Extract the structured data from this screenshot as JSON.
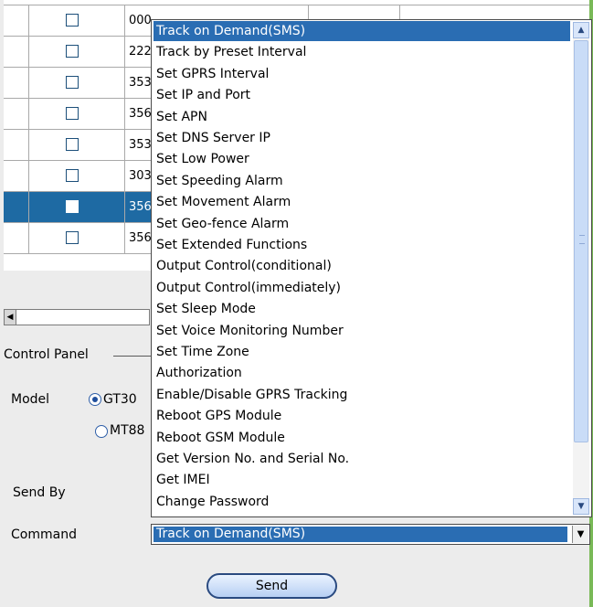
{
  "grid": {
    "rows": [
      {
        "id_text": "000",
        "selected": false
      },
      {
        "id_text": "222",
        "selected": false
      },
      {
        "id_text": "353",
        "selected": false
      },
      {
        "id_text": "356",
        "selected": false
      },
      {
        "id_text": "353",
        "selected": false
      },
      {
        "id_text": "303",
        "selected": false
      },
      {
        "id_text": "356",
        "selected": true
      },
      {
        "id_text": "356",
        "selected": false
      }
    ]
  },
  "control_panel": {
    "legend": "Control Panel",
    "model_label": "Model",
    "model_options": [
      "GT30",
      "MT88"
    ],
    "model_selected": "GT30",
    "send_by_label": "Send By",
    "command_label": "Command",
    "send_button": "Send"
  },
  "command_select": {
    "selected_value": "Track on Demand(SMS)",
    "options": [
      "Track on Demand(SMS)",
      "Track by Preset Interval",
      "Set GPRS Interval",
      "Set IP and Port",
      "Set APN",
      "Set DNS Server IP",
      "Set Low Power",
      "Set Speeding Alarm",
      "Set Movement Alarm",
      "Set Geo-fence Alarm",
      "Set Extended Functions",
      "Output Control(conditional)",
      "Output Control(immediately)",
      "Set Sleep Mode",
      "Set Voice Monitoring Number",
      "Set Time Zone",
      "Authorization",
      "Enable/Disable GPRS Tracking",
      "Reboot GPS Module",
      "Reboot GSM Module",
      "Get Version No. and Serial No.",
      "Get IMEI",
      "Change Password"
    ]
  },
  "colors": {
    "selection": "#2a6db3",
    "border_accent": "#79b957"
  }
}
